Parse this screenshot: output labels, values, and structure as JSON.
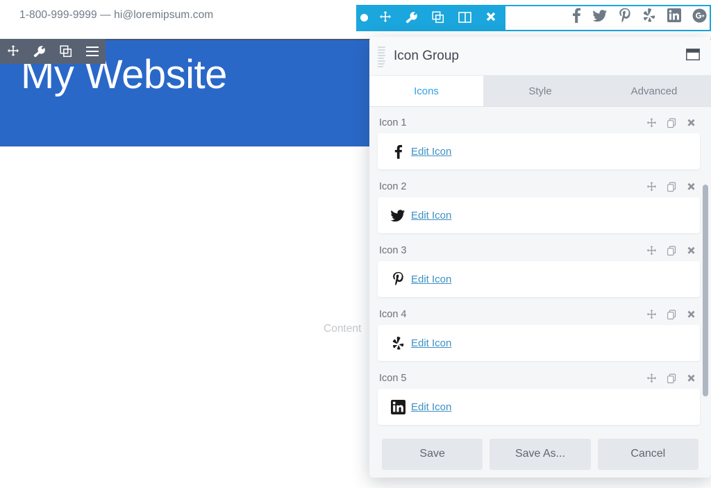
{
  "site": {
    "contact": "1-800-999-9999 — hi@loremipsum.com",
    "hero_title": "My Website",
    "content_label": "Content",
    "social_icons": [
      {
        "name": "facebook-icon",
        "label": "Facebook"
      },
      {
        "name": "twitter-icon",
        "label": "Twitter"
      },
      {
        "name": "pinterest-icon",
        "label": "Pinterest"
      },
      {
        "name": "yelp-icon",
        "label": "Yelp"
      },
      {
        "name": "linkedin-icon",
        "label": "LinkedIn"
      },
      {
        "name": "googleplus-icon",
        "label": "Google Plus"
      }
    ],
    "colors": {
      "hero_blue": "#2a68c8",
      "gray_toolbar": "#586273",
      "cyan_toolbar": "#1ba6dd",
      "link_blue": "#3c91c4",
      "tab_active_blue": "#2ea3e8"
    }
  },
  "gray_toolbar": {
    "buttons": [
      {
        "name": "move-icon",
        "label": "Move"
      },
      {
        "name": "wrench-icon",
        "label": "Settings"
      },
      {
        "name": "duplicate-icon",
        "label": "Duplicate"
      },
      {
        "name": "menu-icon",
        "label": "Menu"
      }
    ]
  },
  "cyan_toolbar": {
    "buttons": [
      {
        "name": "move-icon",
        "label": "Move"
      },
      {
        "name": "wrench-icon",
        "label": "Settings"
      },
      {
        "name": "duplicate-icon",
        "label": "Duplicate"
      },
      {
        "name": "columns-icon",
        "label": "Columns"
      },
      {
        "name": "close-icon",
        "label": "Remove"
      }
    ]
  },
  "modal": {
    "title": "Icon Group",
    "window_button": "minimize-window-icon",
    "drag_handle": "drag-handle-icon",
    "tabs": [
      {
        "label": "Icons",
        "active": true
      },
      {
        "label": "Style",
        "active": false
      },
      {
        "label": "Advanced",
        "active": false
      }
    ],
    "row_actions": [
      {
        "name": "move-icon",
        "label": "Move"
      },
      {
        "name": "duplicate-icon",
        "label": "Duplicate"
      },
      {
        "name": "close-icon",
        "label": "Remove"
      }
    ],
    "icon_rows": [
      {
        "label": "Icon 1",
        "glyph": "facebook-icon",
        "link": "Edit Icon"
      },
      {
        "label": "Icon 2",
        "glyph": "twitter-icon",
        "link": "Edit Icon"
      },
      {
        "label": "Icon 3",
        "glyph": "pinterest-icon",
        "link": "Edit Icon"
      },
      {
        "label": "Icon 4",
        "glyph": "yelp-icon",
        "link": "Edit Icon"
      },
      {
        "label": "Icon 5",
        "glyph": "linkedin-icon",
        "link": "Edit Icon"
      }
    ],
    "footer": {
      "save": "Save",
      "save_as": "Save As...",
      "cancel": "Cancel"
    }
  }
}
